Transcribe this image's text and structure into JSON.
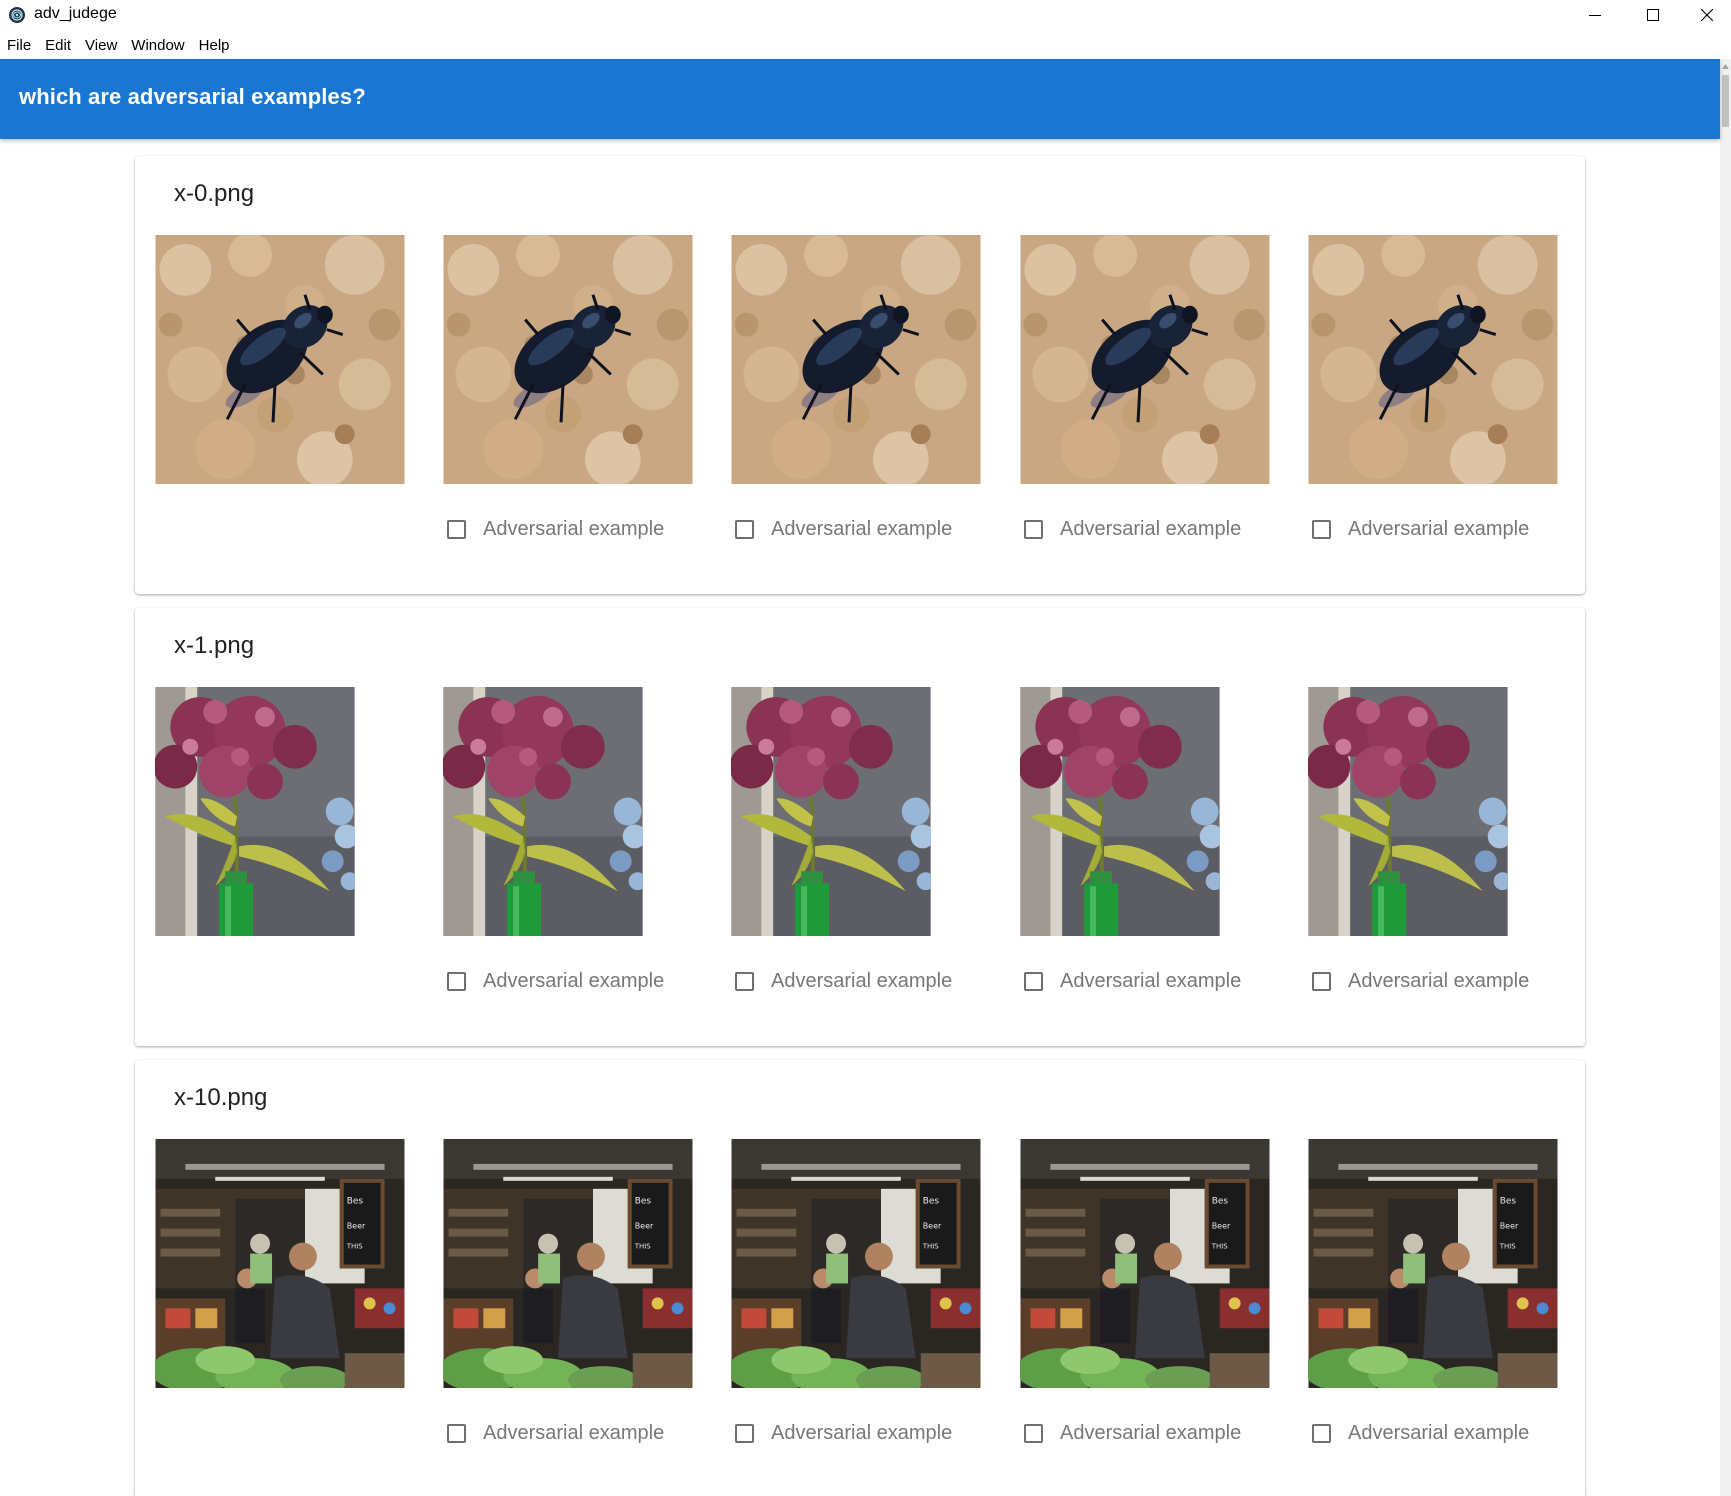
{
  "window": {
    "title": "adv_judege",
    "controls": [
      "minimize-icon",
      "maximize-icon",
      "close-icon"
    ]
  },
  "menubar": {
    "items": [
      "File",
      "Edit",
      "View",
      "Window",
      "Help"
    ]
  },
  "appbar": {
    "title": "which are adversarial examples?",
    "color": "#1976d2"
  },
  "checkbox_label": "Adversarial example",
  "cards": [
    {
      "filename": "x-0.png",
      "image_subject": "beetle",
      "images": 5,
      "checkboxes": [
        {
          "label": "Adversarial example",
          "checked": false
        },
        {
          "label": "Adversarial example",
          "checked": false
        },
        {
          "label": "Adversarial example",
          "checked": false
        },
        {
          "label": "Adversarial example",
          "checked": false
        }
      ]
    },
    {
      "filename": "x-1.png",
      "image_subject": "flower-in-bottle",
      "images": 5,
      "checkboxes": [
        {
          "label": "Adversarial example",
          "checked": false
        },
        {
          "label": "Adversarial example",
          "checked": false
        },
        {
          "label": "Adversarial example",
          "checked": false
        },
        {
          "label": "Adversarial example",
          "checked": false
        }
      ]
    },
    {
      "filename": "x-10.png",
      "image_subject": "market-scene",
      "images": 5,
      "checkboxes": [
        {
          "label": "Adversarial example",
          "checked": false
        },
        {
          "label": "Adversarial example",
          "checked": false
        },
        {
          "label": "Adversarial example",
          "checked": false
        },
        {
          "label": "Adversarial example",
          "checked": false
        }
      ]
    }
  ]
}
